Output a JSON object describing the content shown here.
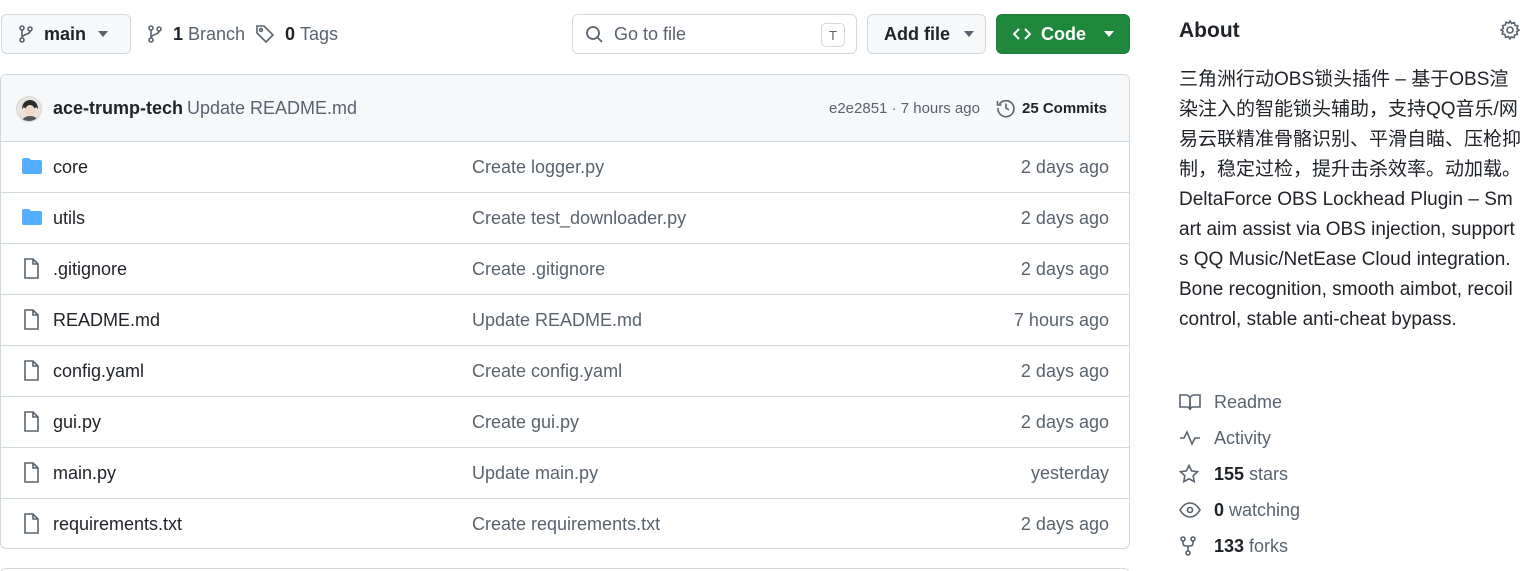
{
  "toolbar": {
    "branch_name": "main",
    "branches_count": "1",
    "branches_label": "Branch",
    "tags_count": "0",
    "tags_label": "Tags",
    "search_placeholder": "Go to file",
    "search_shortcut": "T",
    "add_file_label": "Add file",
    "code_label": "Code"
  },
  "latest_commit": {
    "author": "ace-trump-tech",
    "message": "Update README.md",
    "meta": "e2e2851 · 7 hours ago",
    "commits_count": "25 Commits"
  },
  "files": [
    {
      "type": "folder",
      "name": "core",
      "message": "Create logger.py",
      "age": "2 days ago"
    },
    {
      "type": "folder",
      "name": "utils",
      "message": "Create test_downloader.py",
      "age": "2 days ago"
    },
    {
      "type": "file",
      "name": ".gitignore",
      "message": "Create .gitignore",
      "age": "2 days ago"
    },
    {
      "type": "file",
      "name": "README.md",
      "message": "Update README.md",
      "age": "7 hours ago"
    },
    {
      "type": "file",
      "name": "config.yaml",
      "message": "Create config.yaml",
      "age": "2 days ago"
    },
    {
      "type": "file",
      "name": "gui.py",
      "message": "Create gui.py",
      "age": "2 days ago"
    },
    {
      "type": "file",
      "name": "main.py",
      "message": "Update main.py",
      "age": "yesterday"
    },
    {
      "type": "file",
      "name": "requirements.txt",
      "message": "Create requirements.txt",
      "age": "2 days ago"
    }
  ],
  "about": {
    "title": "About",
    "description": "三角洲行动OBS锁头插件 – 基于OBS渲染注入的智能锁头辅助，支持QQ音乐/网易云联精准骨骼识别、平滑自瞄、压枪抑制，稳定过检，提升击杀效率。动加载。DeltaForce OBS Lockhead Plugin – Smart aim assist via OBS injection, supports QQ Music/NetEase Cloud integration. Bone recognition, smooth aimbot, recoil control, stable anti-cheat bypass.",
    "readme_label": "Readme",
    "activity_label": "Activity",
    "stars_count": "155",
    "stars_label": "stars",
    "watching_count": "0",
    "watching_label": "watching",
    "forks_count": "133",
    "forks_label": "forks"
  },
  "colors": {
    "accent_green": "#1f883d",
    "folder_blue": "#54aeff",
    "muted_text": "#59636e",
    "border": "#d1d9e0"
  },
  "icons": {
    "branch": "git-branch-icon",
    "tag": "tag-icon",
    "search": "search-icon",
    "code": "code-icon",
    "history": "history-icon",
    "folder": "folder-icon",
    "file": "file-icon",
    "gear": "gear-icon",
    "book": "book-icon",
    "pulse": "pulse-icon",
    "star": "star-icon",
    "eye": "eye-icon",
    "fork": "repo-forked-icon"
  }
}
